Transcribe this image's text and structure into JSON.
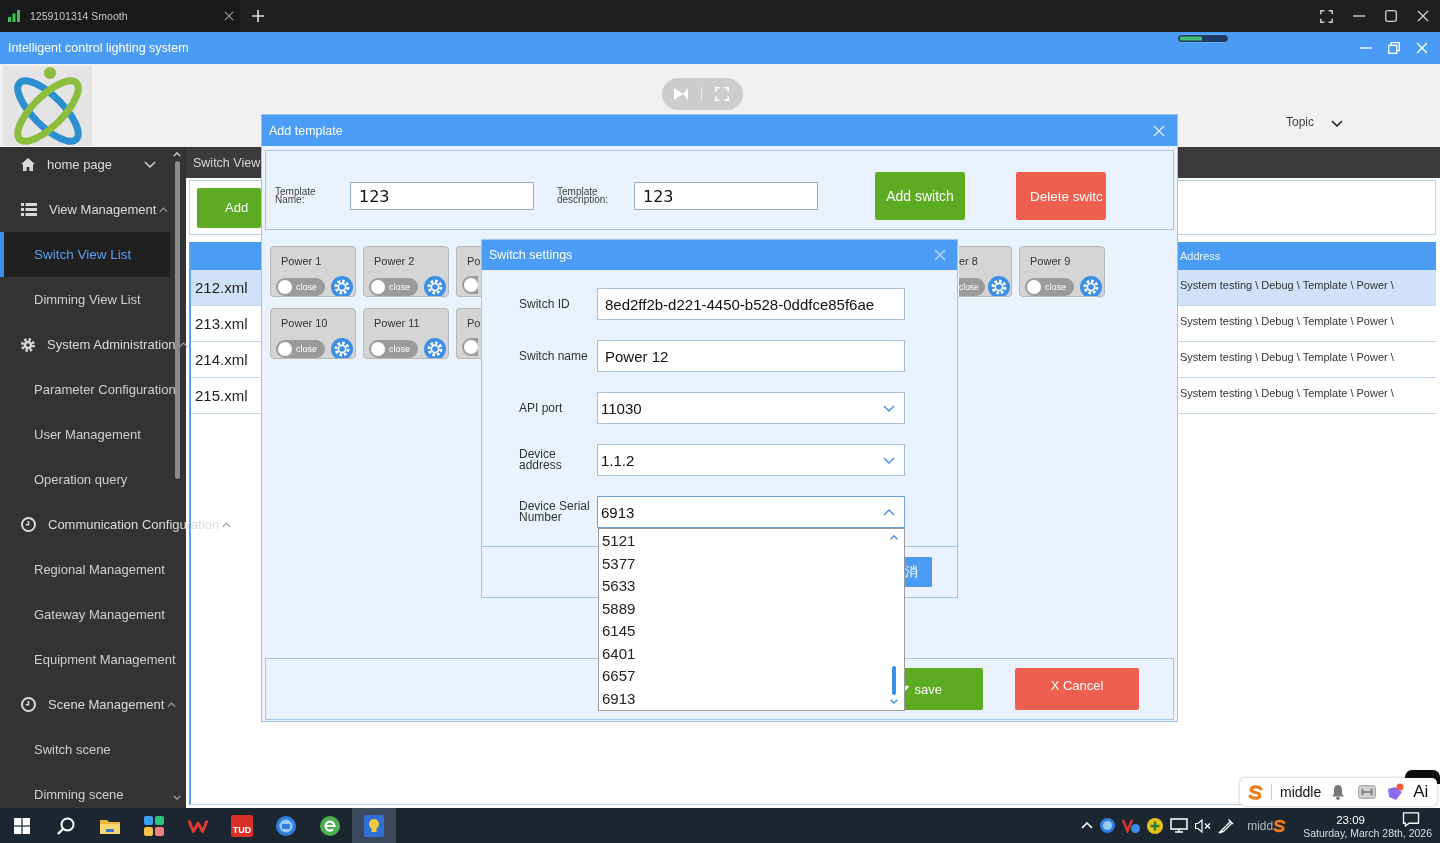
{
  "browser_tab": {
    "title": "1259101314 Smooth"
  },
  "app": {
    "title": "Intelligent control lighting system"
  },
  "header": {
    "topic": "Topic"
  },
  "sidebar": {
    "items": [
      {
        "label": "home page",
        "expanded": false
      },
      {
        "label": "View Management",
        "expanded": true,
        "children": [
          {
            "label": "Switch View List",
            "selected": true
          },
          {
            "label": "Dimming View List",
            "selected": false
          }
        ]
      },
      {
        "label": "System Administration",
        "expanded": true,
        "children": [
          {
            "label": "Parameter Configuration",
            "selected": false
          },
          {
            "label": "User Management",
            "selected": false
          },
          {
            "label": "Operation query",
            "selected": false
          }
        ]
      },
      {
        "label": "Communication Configuration",
        "expanded": true,
        "children": [
          {
            "label": "Regional Management",
            "selected": false
          },
          {
            "label": "Gateway Management",
            "selected": false
          },
          {
            "label": "Equipment Management",
            "selected": false
          }
        ]
      },
      {
        "label": "Scene Management",
        "expanded": true,
        "children": [
          {
            "label": "Switch scene",
            "selected": false
          },
          {
            "label": "Dimming scene",
            "selected": false
          }
        ]
      }
    ]
  },
  "main": {
    "tab_title": "Switch View",
    "add_button": "Add",
    "table": {
      "address_heading": "Address",
      "rows": [
        {
          "file": "212.xml",
          "address": "System testing \\ Debug \\ Template \\ Power \\",
          "selected": true
        },
        {
          "file": "213.xml",
          "address": "System testing \\ Debug \\ Template \\ Power \\",
          "selected": false
        },
        {
          "file": "214.xml",
          "address": "System testing \\ Debug \\ Template \\ Power \\",
          "selected": false
        },
        {
          "file": "215.xml",
          "address": "System testing \\ Debug \\ Template \\ Power \\",
          "selected": false
        }
      ]
    }
  },
  "add_template": {
    "title": "Add template",
    "name_label": "Template Name:",
    "name_value": "123",
    "description_label": "Template description:",
    "description_value": "123",
    "add_switch": "Add switch",
    "delete_switch": "Delete switc",
    "switch_rows": [
      {
        "cards": [
          {
            "label": "Power 1",
            "on": false,
            "state_text": "close",
            "kind": "full"
          },
          {
            "label": "Power 2",
            "on": false,
            "state_text": "close",
            "kind": "full"
          },
          {
            "label": "Po",
            "on": false,
            "kind": "cut_right"
          },
          {
            "label": "er 8",
            "on": false,
            "state_text": "close",
            "kind": "cut_left"
          },
          {
            "label": "Power 9",
            "on": false,
            "state_text": "close",
            "kind": "full"
          }
        ]
      },
      {
        "cards": [
          {
            "label": "Power 10",
            "on": false,
            "state_text": "close",
            "kind": "full"
          },
          {
            "label": "Power 11",
            "on": false,
            "state_text": "close",
            "kind": "full"
          },
          {
            "label": "Po",
            "on": false,
            "kind": "cut_right"
          }
        ]
      }
    ],
    "save": "save",
    "cancel": "X Cancel"
  },
  "switch_settings": {
    "title": "Switch settings",
    "fields": [
      {
        "label": "Switch ID",
        "kind": "text",
        "value": "8ed2ff2b-d221-4450-b528-0ddfce85f6ae"
      },
      {
        "label": "Switch name",
        "kind": "text",
        "value": "Power 12"
      },
      {
        "label": "API port",
        "kind": "select",
        "value": "11030",
        "open": false
      },
      {
        "label": "Device address",
        "kind": "select",
        "value": "1.1.2",
        "open": false
      },
      {
        "label": "Device Serial Number",
        "kind": "select",
        "value": "6913",
        "open": true,
        "options": [
          "5121",
          "5377",
          "5633",
          "5889",
          "6145",
          "6401",
          "6657",
          "6913"
        ]
      }
    ],
    "footer_button": "消"
  },
  "taskbar": {
    "buttons": [
      {
        "selected": false
      },
      {
        "selected": false
      },
      {
        "selected": false
      },
      {
        "selected": false
      },
      {
        "selected": false
      },
      {
        "selected": false,
        "text": "TUD"
      },
      {
        "selected": false
      },
      {
        "selected": false
      },
      {
        "selected": true
      }
    ],
    "tray_text": "midd",
    "time": "23:09",
    "date": "Saturday, March 28th, 2026"
  },
  "ime_toolbar": {
    "text": "middle",
    "ai_label": "Ai"
  }
}
